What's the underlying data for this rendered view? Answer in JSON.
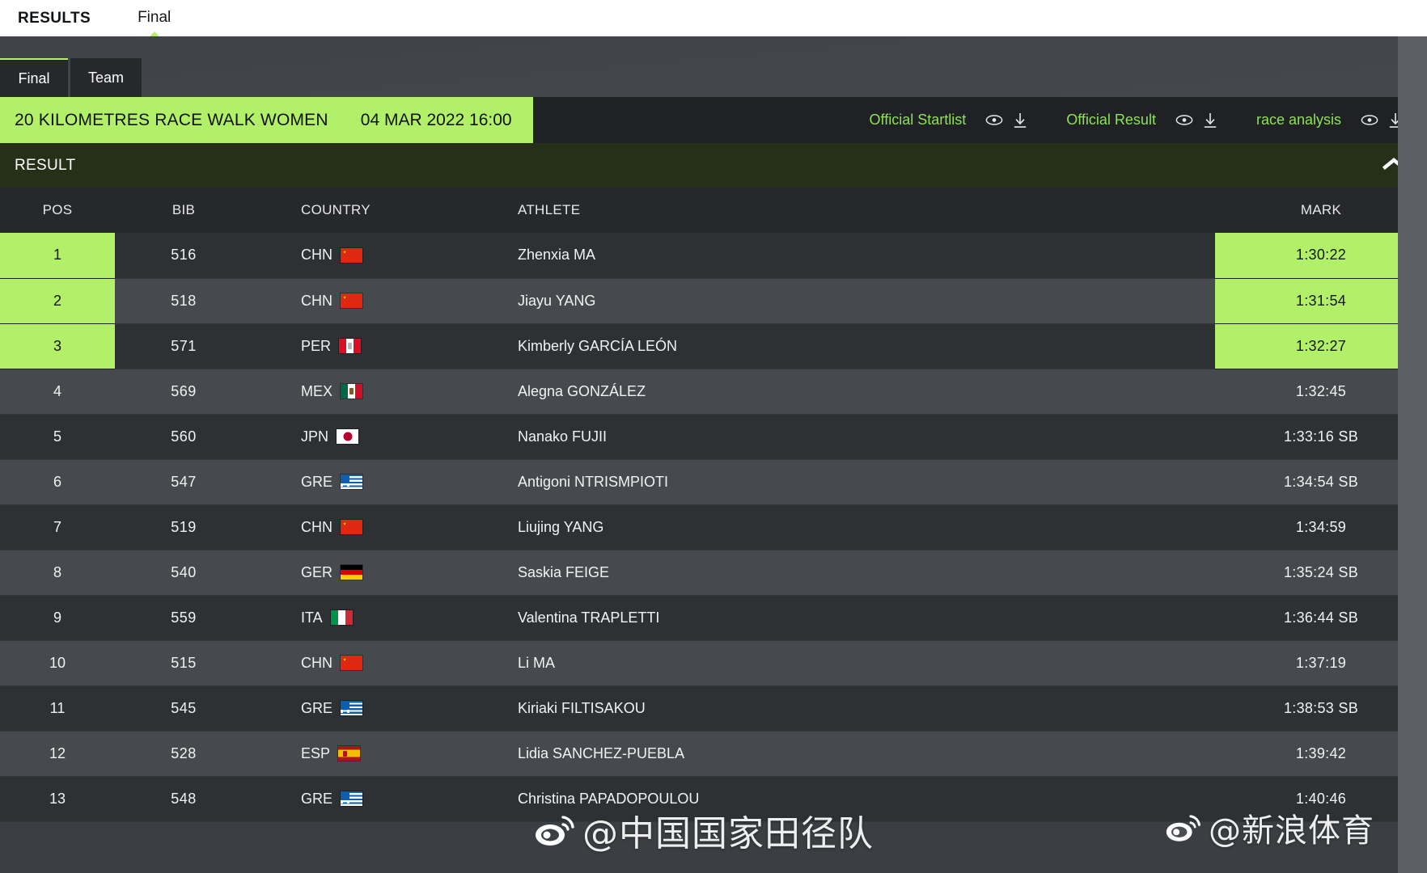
{
  "topbar": {
    "results_label": "RESULTS",
    "tab_label": "Final"
  },
  "view_tabs": [
    {
      "label": "Final",
      "active": true
    },
    {
      "label": "Team",
      "active": false
    }
  ],
  "event": {
    "title": "20 KILOMETRES RACE WALK WOMEN",
    "datetime": "04 MAR 2022 16:00",
    "links": [
      {
        "label": "Official Startlist",
        "view_icon": "eye-icon",
        "download_icon": "download-icon"
      },
      {
        "label": "Official Result",
        "view_icon": "eye-icon",
        "download_icon": "download-icon"
      },
      {
        "label": "race analysis",
        "view_icon": "eye-icon",
        "download_icon": "download-icon"
      }
    ]
  },
  "section": {
    "label": "RESULT",
    "collapse_icon": "chevron-up-icon"
  },
  "table": {
    "columns": [
      "POS",
      "BIB",
      "COUNTRY",
      "ATHLETE",
      "MARK"
    ],
    "rows": [
      {
        "pos": "1",
        "bib": "516",
        "country": "CHN",
        "athlete": "Zhenxia MA",
        "mark": "1:30:22",
        "medal": true
      },
      {
        "pos": "2",
        "bib": "518",
        "country": "CHN",
        "athlete": "Jiayu YANG",
        "mark": "1:31:54",
        "medal": true
      },
      {
        "pos": "3",
        "bib": "571",
        "country": "PER",
        "athlete": "Kimberly GARCÍA LEÓN",
        "mark": "1:32:27",
        "medal": true
      },
      {
        "pos": "4",
        "bib": "569",
        "country": "MEX",
        "athlete": "Alegna GONZÁLEZ",
        "mark": "1:32:45",
        "medal": false
      },
      {
        "pos": "5",
        "bib": "560",
        "country": "JPN",
        "athlete": "Nanako FUJII",
        "mark": "1:33:16 SB",
        "medal": false
      },
      {
        "pos": "6",
        "bib": "547",
        "country": "GRE",
        "athlete": "Antigoni NTRISMPIOTI",
        "mark": "1:34:54 SB",
        "medal": false
      },
      {
        "pos": "7",
        "bib": "519",
        "country": "CHN",
        "athlete": "Liujing YANG",
        "mark": "1:34:59",
        "medal": false
      },
      {
        "pos": "8",
        "bib": "540",
        "country": "GER",
        "athlete": "Saskia FEIGE",
        "mark": "1:35:24 SB",
        "medal": false
      },
      {
        "pos": "9",
        "bib": "559",
        "country": "ITA",
        "athlete": "Valentina TRAPLETTI",
        "mark": "1:36:44 SB",
        "medal": false
      },
      {
        "pos": "10",
        "bib": "515",
        "country": "CHN",
        "athlete": "Li MA",
        "mark": "1:37:19",
        "medal": false
      },
      {
        "pos": "11",
        "bib": "545",
        "country": "GRE",
        "athlete": "Kiriaki FILTISAKOU",
        "mark": "1:38:53 SB",
        "medal": false
      },
      {
        "pos": "12",
        "bib": "528",
        "country": "ESP",
        "athlete": "Lidia SANCHEZ-PUEBLA",
        "mark": "1:39:42",
        "medal": false
      },
      {
        "pos": "13",
        "bib": "548",
        "country": "GRE",
        "athlete": "Christina PAPADOPOULOU",
        "mark": "1:40:46",
        "medal": false
      }
    ]
  },
  "watermarks": [
    {
      "handle": "@中国国家田径队",
      "logo": "weibo-logo"
    },
    {
      "handle": "@新浪体育",
      "logo": "weibo-logo"
    }
  ],
  "colors": {
    "accent_green": "#b3f069",
    "link_green": "#8fe05a",
    "section_bg": "#263019",
    "row_bg": "#2e3134",
    "row_bg_alt": "#46494d",
    "header_bg": "#26282b",
    "page_bg": "#4a4e53"
  }
}
